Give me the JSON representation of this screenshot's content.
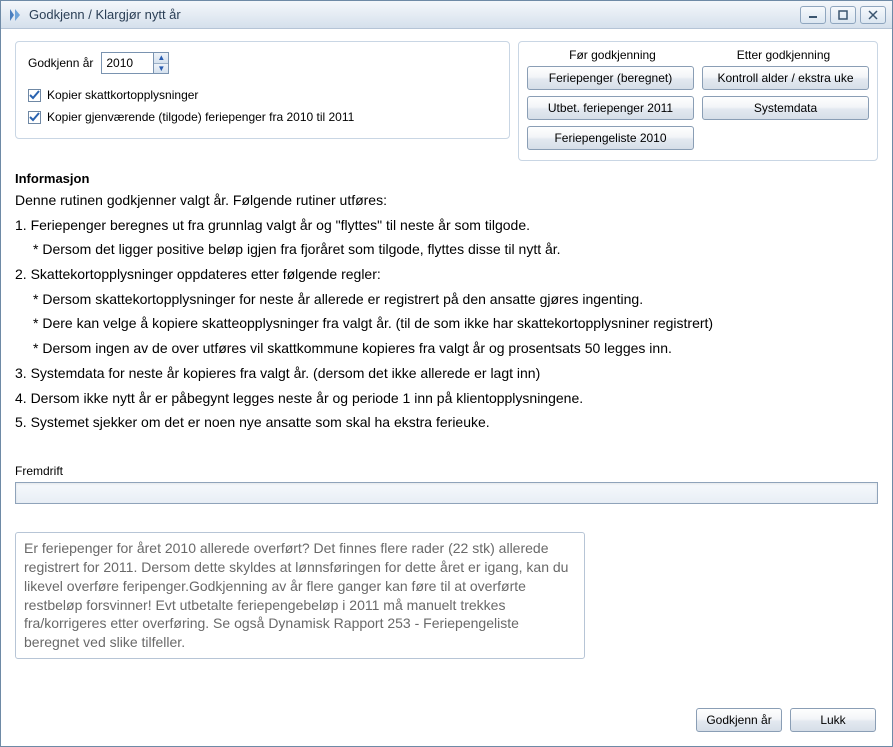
{
  "window": {
    "title": "Godkjenn / Klargjør nytt år"
  },
  "approve": {
    "year_label": "Godkjenn år",
    "year_value": "2010",
    "copy_tax_label": "Kopier skattkortopplysninger",
    "copy_tax_checked": true,
    "copy_holiday_label": "Kopier gjenværende (tilgode) feriepenger fra 2010 til 2011",
    "copy_holiday_checked": true
  },
  "groups": {
    "before_label": "Før godkjenning",
    "after_label": "Etter godkjenning",
    "before_buttons": {
      "b1": "Feriepenger (beregnet)",
      "b2": "Utbet. feriepenger 2011",
      "b3": "Feriepengeliste 2010"
    },
    "after_buttons": {
      "a1": "Kontroll  alder / ekstra uke",
      "a2": "Systemdata"
    }
  },
  "info": {
    "heading": "Informasjon",
    "intro": "Denne rutinen godkjenner valgt år. Følgende rutiner utføres:",
    "l1": "1. Feriepenger beregnes ut fra grunnlag valgt år og \"flyttes\" til neste år som tilgode.",
    "l1a": "* Dersom det ligger positive beløp igjen fra fjoråret som tilgode, flyttes disse til nytt år.",
    "l2": "2. Skattekortopplysninger oppdateres etter følgende regler:",
    "l2a": "* Dersom skattekortopplysninger for neste år allerede er registrert på den ansatte gjøres ingenting.",
    "l2b": "* Dere kan velge å kopiere skatteopplysninger fra valgt år. (til de som ikke har skattekortopplysniner registrert)",
    "l2c": "* Dersom ingen av de over utføres vil skattkommune kopieres fra valgt år og prosentsats 50 legges inn.",
    "l3": "3. Systemdata for neste år kopieres fra valgt år. (dersom det ikke allerede er lagt inn)",
    "l4": "4. Dersom ikke nytt år er påbegynt legges neste år og periode 1 inn på klientopplysningene.",
    "l5": "5. Systemet sjekker om det er noen nye ansatte som skal ha ekstra ferieuke."
  },
  "progress": {
    "label": "Fremdrift"
  },
  "message": "Er feriepenger for året 2010 allerede overført? Det finnes flere rader (22 stk) allerede registrert for 2011. Dersom dette skyldes at lønnsføringen for dette året er igang, kan du likevel overføre feripenger.Godkjenning av år flere ganger kan føre til at overførte restbeløp forsvinner! Evt utbetalte feriepengebeløp i 2011 må manuelt trekkes fra/korrigeres etter overføring.  Se også Dynamisk Rapport 253 - Feriepengeliste beregnet ved slike tilfeller.",
  "footer": {
    "approve": "Godkjenn år",
    "close": "Lukk"
  }
}
